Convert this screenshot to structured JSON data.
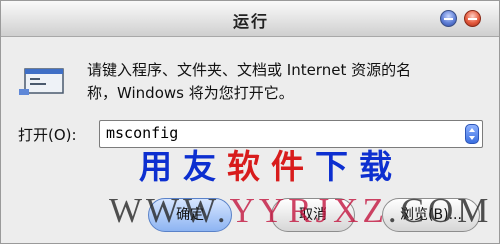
{
  "window": {
    "title": "运行"
  },
  "description": {
    "line1": "请键入程序、文件夹、文档或 Internet 资源的名",
    "line2": "称，Windows 将为您打开它。"
  },
  "open": {
    "label": "打开(O):",
    "value": "msconfig"
  },
  "buttons": {
    "ok": "确定",
    "cancel": "取消",
    "browse": "浏览(B)..."
  },
  "watermark": {
    "part1": "用友",
    "part2": "软件",
    "part3": "下载",
    "url_a": "WWW.",
    "url_b": "YYRJXZ",
    "url_c": ".COM"
  },
  "icons": [
    "run-program-icon",
    "minimize-icon",
    "close-icon",
    "combo-arrow-icon"
  ],
  "colors": {
    "watermark_blue": "#0d2fd0",
    "watermark_red": "#d81c1c",
    "close": "#e55b3e",
    "minimize": "#5f7fd6"
  }
}
